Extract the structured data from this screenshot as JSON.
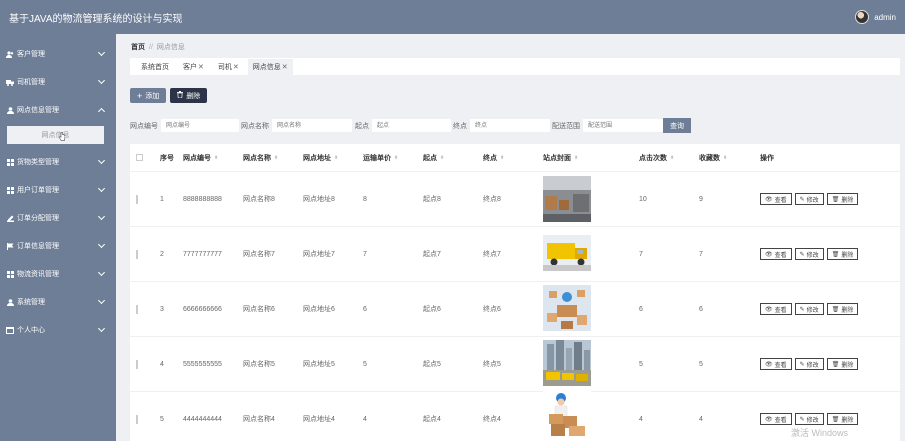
{
  "app": {
    "title": "基于JAVA的物流管理系统的设计与实现",
    "user": "admin"
  },
  "sidebar": {
    "items": [
      {
        "label": "客户管理",
        "icon": "people-icon"
      },
      {
        "label": "司机管理",
        "icon": "truck-icon"
      },
      {
        "label": "网点信息管理",
        "icon": "user-icon",
        "expanded": true,
        "sub": [
          "网点信息"
        ]
      },
      {
        "label": "货物类型管理",
        "icon": "grid-icon"
      },
      {
        "label": "用户订单管理",
        "icon": "grid-icon"
      },
      {
        "label": "订单分配管理",
        "icon": "edit-icon"
      },
      {
        "label": "订单信息管理",
        "icon": "flag-icon"
      },
      {
        "label": "物流资讯管理",
        "icon": "grid-icon"
      },
      {
        "label": "系统管理",
        "icon": "user-icon"
      },
      {
        "label": "个人中心",
        "icon": "card-icon"
      }
    ]
  },
  "breadcrumb": {
    "home": "首页",
    "sep": "//",
    "current": "网点信息"
  },
  "tabs": [
    {
      "label": "系统首页",
      "closable": false
    },
    {
      "label": "客户",
      "closable": true
    },
    {
      "label": "司机",
      "closable": true
    },
    {
      "label": "网点信息",
      "closable": true,
      "active": true
    }
  ],
  "toolbar": {
    "add": "添加",
    "delete": "删除",
    "query": "查询"
  },
  "filters": [
    {
      "label": "网点编号",
      "placeholder": "网点编号"
    },
    {
      "label": "网点名称",
      "placeholder": "网点名称"
    },
    {
      "label": "起点",
      "placeholder": "起点"
    },
    {
      "label": "终点",
      "placeholder": "终点"
    },
    {
      "label": "配送范围",
      "placeholder": "配送范围"
    }
  ],
  "table": {
    "headers": [
      "序号",
      "网点编号",
      "网点名称",
      "网点地址",
      "运输单价",
      "起点",
      "终点",
      "站点封面",
      "点击次数",
      "收藏数",
      "操作"
    ],
    "rows": [
      [
        "1",
        "8888888888",
        "网点名称8",
        "网点地址8",
        "8",
        "起点8",
        "终点8",
        "10",
        "9"
      ],
      [
        "2",
        "7777777777",
        "网点名称7",
        "网点地址7",
        "7",
        "起点7",
        "终点7",
        "7",
        "7"
      ],
      [
        "3",
        "6666666666",
        "网点名称6",
        "网点地址6",
        "6",
        "起点6",
        "终点6",
        "6",
        "6"
      ],
      [
        "4",
        "5555555555",
        "网点名称5",
        "网点地址5",
        "5",
        "起点5",
        "终点5",
        "5",
        "5"
      ],
      [
        "5",
        "4444444444",
        "网点名称4",
        "网点地址4",
        "4",
        "起点4",
        "终点4",
        "4",
        "4"
      ]
    ],
    "actions": {
      "view": "查看",
      "edit": "修改",
      "delete": "删除"
    }
  },
  "watermark": "激活 Windows",
  "colors": {
    "sidebar": "#6f7e97",
    "dark_button": "#2c3448",
    "background": "#eef0f4"
  }
}
